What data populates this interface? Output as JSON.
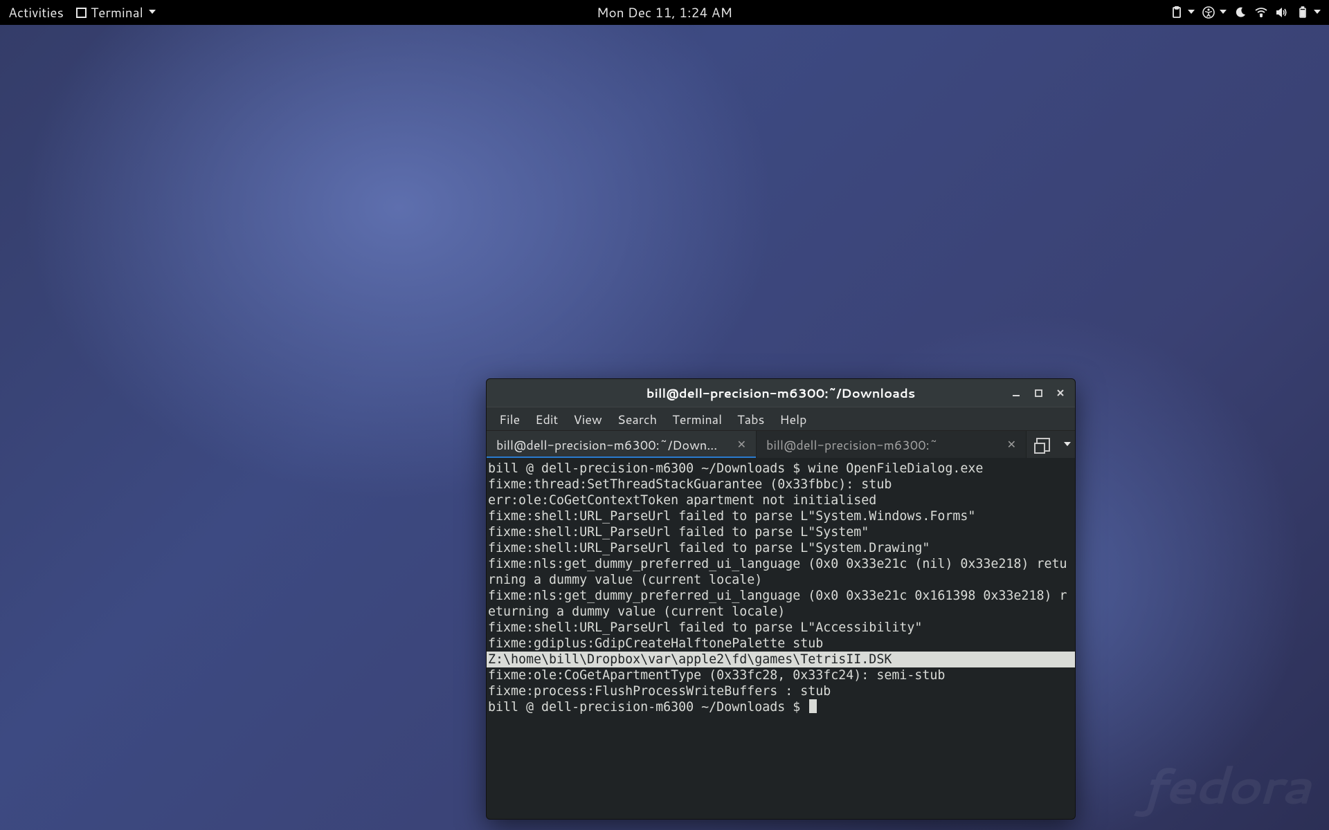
{
  "panel": {
    "activities": "Activities",
    "app": "Terminal",
    "clock": "Mon Dec 11,  1:24 AM"
  },
  "window": {
    "title": "bill@dell-precision-m6300:~/Downloads",
    "menu": [
      "File",
      "Edit",
      "View",
      "Search",
      "Terminal",
      "Tabs",
      "Help"
    ],
    "tabs": [
      {
        "label": "bill@dell-precision-m6300:~/Down…",
        "active": true
      },
      {
        "label": "bill@dell-precision-m6300:~",
        "active": false
      }
    ],
    "lines": [
      "bill @ dell-precision-m6300 ~/Downloads $ wine OpenFileDialog.exe",
      "fixme:thread:SetThreadStackGuarantee (0x33fbbc): stub",
      "err:ole:CoGetContextToken apartment not initialised",
      "fixme:shell:URL_ParseUrl failed to parse L\"System.Windows.Forms\"",
      "fixme:shell:URL_ParseUrl failed to parse L\"System\"",
      "fixme:shell:URL_ParseUrl failed to parse L\"System.Drawing\"",
      "fixme:nls:get_dummy_preferred_ui_language (0x0 0x33e21c (nil) 0x33e218) returning a dummy value (current locale)",
      "fixme:nls:get_dummy_preferred_ui_language (0x0 0x33e21c 0x161398 0x33e218) returning a dummy value (current locale)",
      "fixme:shell:URL_ParseUrl failed to parse L\"Accessibility\"",
      "fixme:gdiplus:GdipCreateHalftonePalette stub",
      "Z:\\home\\bill\\Dropbox\\var\\apple2\\fd\\games\\TetrisII.DSK",
      "fixme:ole:CoGetApartmentType (0x33fc28, 0x33fc24): semi-stub",
      "fixme:process:FlushProcessWriteBuffers : stub",
      "bill @ dell-precision-m6300 ~/Downloads $ "
    ],
    "selected_line_index": 10
  },
  "watermark": "fedora"
}
